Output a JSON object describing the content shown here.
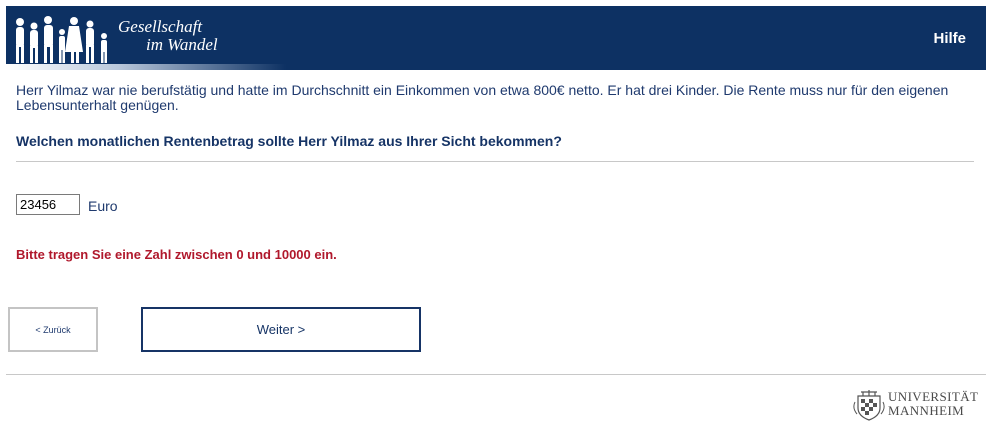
{
  "header": {
    "logo_line1": "Gesellschaft",
    "logo_line2": "im Wandel",
    "help_label": "Hilfe",
    "background_color": "#0d3163"
  },
  "content": {
    "intro_text": "Herr Yilmaz war nie berufstätig und hatte im Durchschnitt ein Einkommen von etwa 800€ netto. Er hat drei Kinder. Die Rente muss nur für den eigenen Lebensunterhalt genügen.",
    "question": "Welchen monatlichen Rentenbetrag sollte Herr Yilmaz aus Ihrer Sicht bekommen?",
    "amount_value": "23456",
    "unit_label": "Euro",
    "error_message": "Bitte tragen Sie eine Zahl zwischen 0 und 10000 ein.",
    "error_color": "#b0182c"
  },
  "navigation": {
    "back_label": "< Zurück",
    "next_label": "Weiter >"
  },
  "footer": {
    "university_line1": "UNIVERSITÄT",
    "university_line2": "MANNHEIM"
  }
}
